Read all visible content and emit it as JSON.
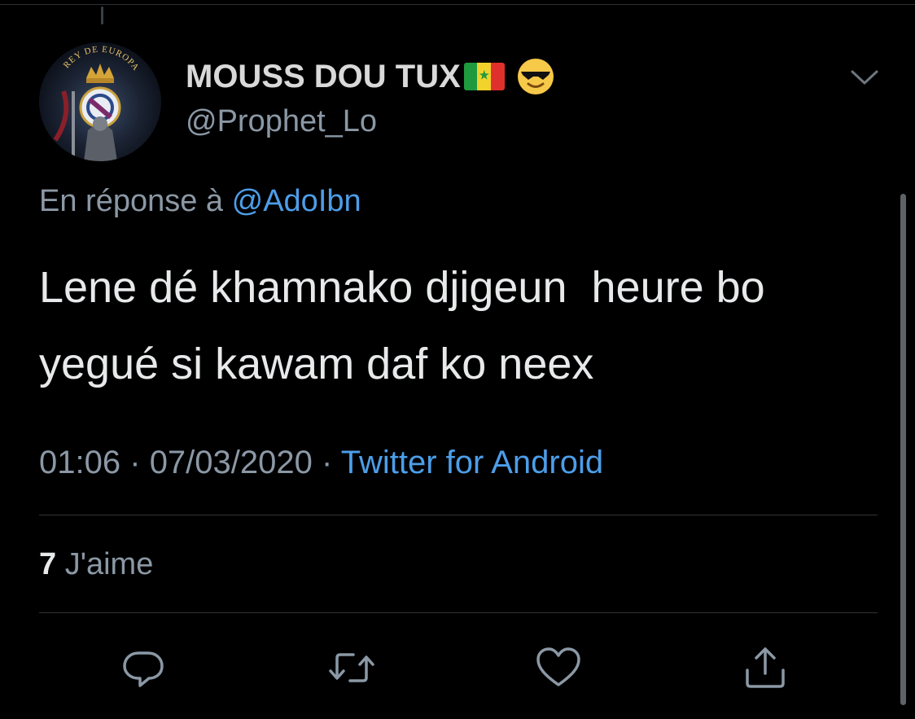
{
  "tweet": {
    "display_name": "MOUSS DOU TUX",
    "handle": "@Prophet_Lo",
    "avatar_text": "REY DE EUROPA",
    "reply_prefix": "En réponse à",
    "reply_to": "@AdoIbn",
    "text": "Lene dé khamnako djigeun  heure bo\nyegué si kawam daf ko neex",
    "time": "01:06",
    "separator": "·",
    "date": "07/03/2020",
    "source": "Twitter for Android",
    "likes_count": "7",
    "likes_label": "J'aime"
  },
  "icons": {
    "flag": "senegal-flag-icon",
    "emoji": "sunglasses-emoji-icon",
    "menu": "chevron-down-icon",
    "reply": "reply-bubble-icon",
    "retweet": "retweet-icon",
    "like": "heart-icon",
    "share": "share-icon"
  },
  "colors": {
    "background": "#000000",
    "text": "#e7e9ea",
    "secondary": "#8b98a5",
    "link": "#4c9ee9",
    "divider": "#2f3336"
  }
}
